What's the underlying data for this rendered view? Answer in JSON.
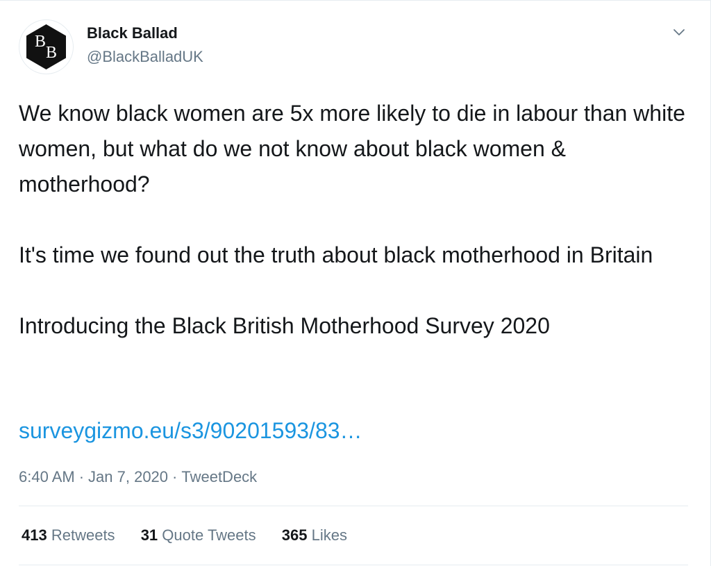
{
  "author": {
    "name": "Black Ballad",
    "handle": "@BlackBalladUK",
    "avatar_icon": "bb-logo-icon",
    "avatar_letters": "BB"
  },
  "tweet": {
    "paragraphs": [
      "We know black women are 5x more likely to die in labour than white women, but what do we not know about black women & motherhood?",
      "It's time we found out the truth about black motherhood in Britain",
      "Introducing the Black British Motherhood Survey 2020"
    ],
    "link": "surveygizmo.eu/s3/90201593/83…"
  },
  "meta": {
    "time": "6:40 AM",
    "separator": "·",
    "date": "Jan 7, 2020",
    "source": "TweetDeck"
  },
  "stats": {
    "retweets": {
      "count": "413",
      "label": "Retweets"
    },
    "quotes": {
      "count": "31",
      "label": "Quote Tweets"
    },
    "likes": {
      "count": "365",
      "label": "Likes"
    }
  },
  "colors": {
    "text": "#14171a",
    "secondary": "#657786",
    "link": "#1b95e0",
    "divider": "#e6ecf0",
    "avatar_bg": "#111111"
  }
}
